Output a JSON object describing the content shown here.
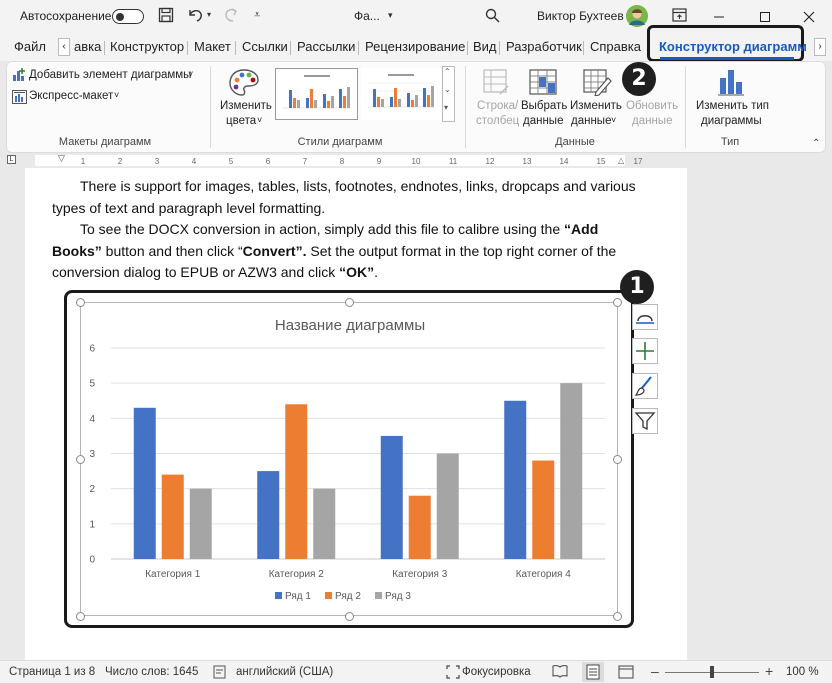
{
  "titlebar": {
    "autosave_label": "Автосохранение",
    "doc_name": "Фа...",
    "user_name": "Виктор Бухтеев"
  },
  "tabs": [
    {
      "label": "Файл"
    },
    {
      "label": "авка"
    },
    {
      "label": "Конструктор"
    },
    {
      "label": "Макет"
    },
    {
      "label": "Ссылки"
    },
    {
      "label": "Рассылки"
    },
    {
      "label": "Рецензирование"
    },
    {
      "label": "Вид"
    },
    {
      "label": "Разработчик"
    },
    {
      "label": "Справка"
    },
    {
      "label": "Конструктор диаграмм"
    }
  ],
  "ribbon": {
    "add_element": "Добавить элемент диаграммы",
    "express_layout": "Экспресс-макет",
    "group_layouts": "Макеты диаграмм",
    "change_colors_1": "Изменить",
    "change_colors_2": "цвета",
    "group_styles": "Стили диаграмм",
    "row_col_1": "Строка/",
    "row_col_2": "столбец",
    "select_data_1": "Выбрать",
    "select_data_2": "данные",
    "edit_data_1": "Изменить",
    "edit_data_2": "данные",
    "refresh_data_1": "Обновить",
    "refresh_data_2": "данные",
    "group_data": "Данные",
    "change_type_1": "Изменить тип",
    "change_type_2": "диаграммы",
    "group_type": "Тип"
  },
  "document": {
    "p1": "There is support for images, tables, lists, footnotes, endnotes, links, dropcaps and various types of text and paragraph level formatting.",
    "p2_a": "To see the DOCX conversion in action, simply add this file to calibre using the ",
    "p2_b": "“Add Books”",
    "p2_c": " button and then click “",
    "p2_d": "Convert”.",
    "p2_e": "  Set the output format in the top right corner of the conversion dialog to EPUB or AZW3 and click ",
    "p2_f": "“OK”",
    "p2_g": "."
  },
  "annotations": {
    "badge1": "1",
    "badge2": "2"
  },
  "chart_data": {
    "type": "bar",
    "title": "Название диаграммы",
    "categories": [
      "Категория 1",
      "Категория 2",
      "Категория 3",
      "Категория 4"
    ],
    "series": [
      {
        "name": "Ряд 1",
        "values": [
          4.3,
          2.5,
          3.5,
          4.5
        ],
        "color": "#4472c4"
      },
      {
        "name": "Ряд 2",
        "values": [
          2.4,
          4.4,
          1.8,
          2.8
        ],
        "color": "#ed7d31"
      },
      {
        "name": "Ряд 3",
        "values": [
          2,
          2,
          3,
          5
        ],
        "color": "#a5a5a5"
      }
    ],
    "yticks": [
      "0",
      "1",
      "2",
      "3",
      "4",
      "5",
      "6"
    ],
    "ylim": [
      0,
      6
    ],
    "grid": true,
    "legend": "bottom"
  },
  "status": {
    "page": "Страница 1 из 8",
    "words": "Число слов: 1645",
    "language": "английский (США)",
    "focus": "Фокусировка",
    "zoom": "100 %"
  }
}
